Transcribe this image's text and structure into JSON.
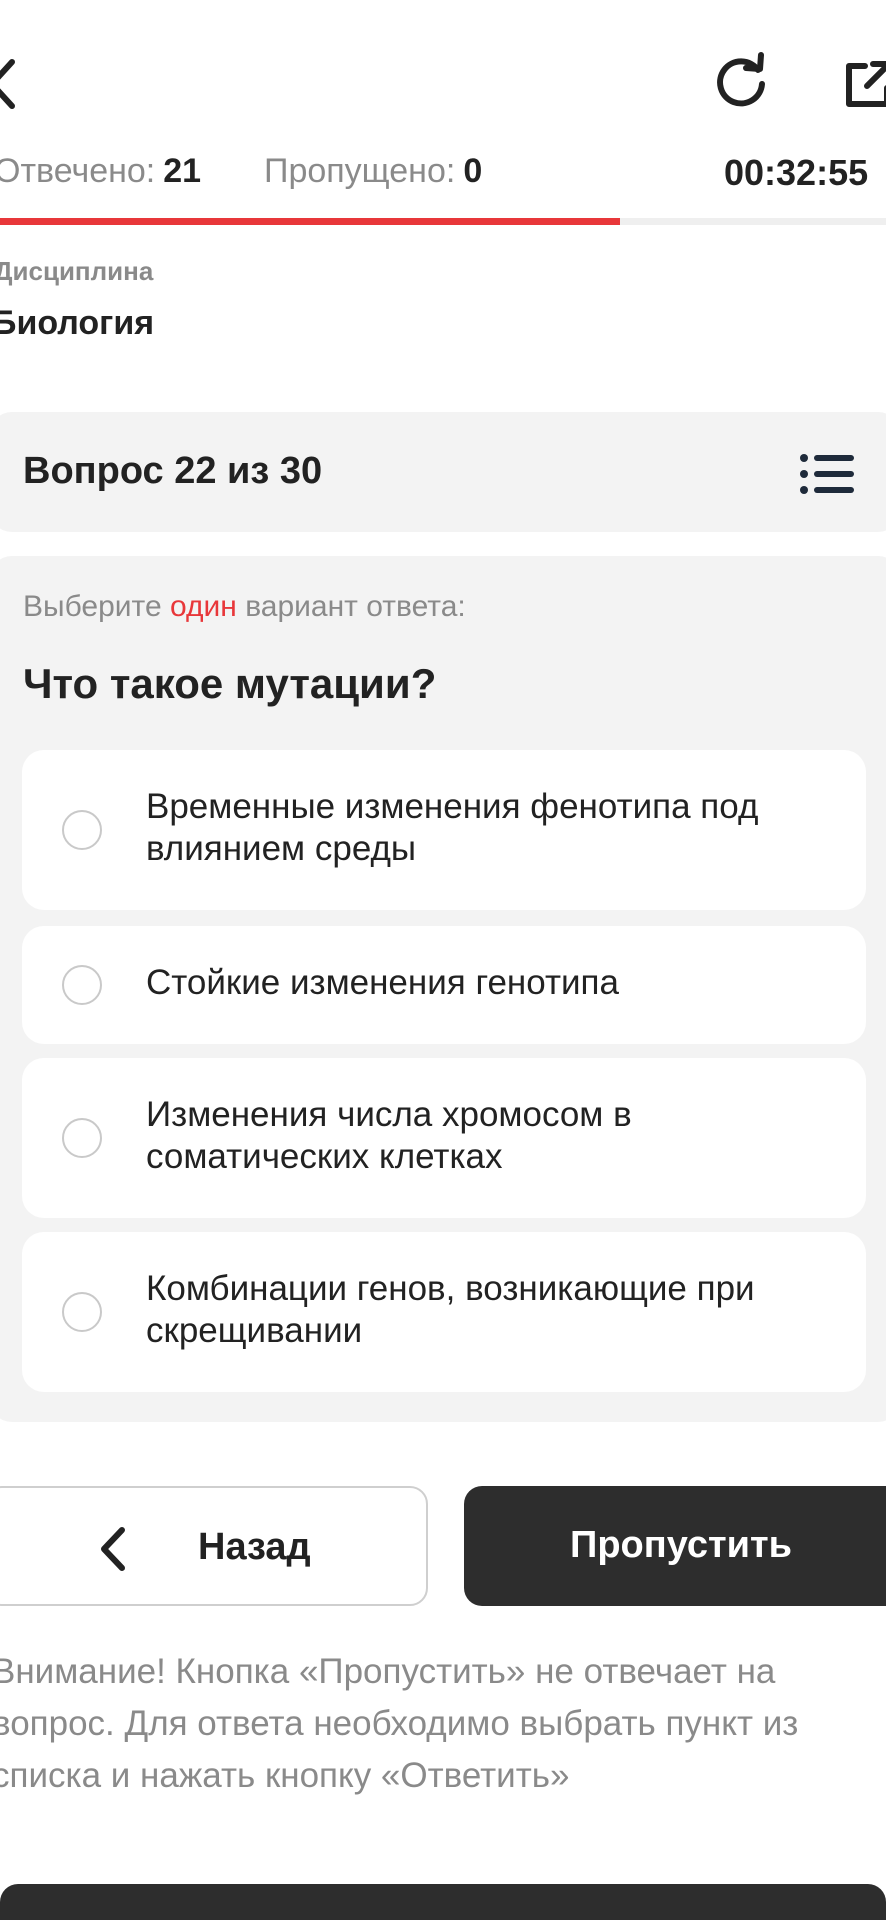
{
  "stats": {
    "answered_label": "Отвечено:",
    "answered_value": "21",
    "skipped_label": "Пропущено:",
    "skipped_value": "0",
    "timer": "00:32:55",
    "progress_fraction": 0.7
  },
  "discipline": {
    "label": "Дисциплина",
    "value": "Биология"
  },
  "question_header": {
    "title": "Вопрос 22 из 30"
  },
  "question": {
    "instruction_before": "Выберите",
    "instruction_accent": "один",
    "instruction_after": "вариант ответа:",
    "text": "Что такое мутации?",
    "options": [
      {
        "label": "Временные изменения фенотипа под влиянием среды",
        "selected": false
      },
      {
        "label": "Стойкие изменения генотипа",
        "selected": false
      },
      {
        "label": "Изменения числа хромосом в соматических клетках",
        "selected": false
      },
      {
        "label": "Комбинации генов, возникающие при скрещивании",
        "selected": false
      }
    ]
  },
  "buttons": {
    "back_label": "Назад",
    "skip_label": "Пропустить"
  },
  "warning": "Внимание! Кнопка «Пропустить» не отвечает на вопрос. Для ответа необходимо выбрать пункт из списка и нажать кнопку «Ответить»",
  "colors": {
    "accent": "#e8373a",
    "dark": "#2d2d2d",
    "muted": "#8a8a8a",
    "card_bg": "#f3f3f3"
  },
  "icons": {
    "back": "chevron-left-icon",
    "refresh": "refresh-icon",
    "external": "external-link-icon",
    "question_list": "list-icon",
    "back_button": "chevron-left-icon"
  }
}
